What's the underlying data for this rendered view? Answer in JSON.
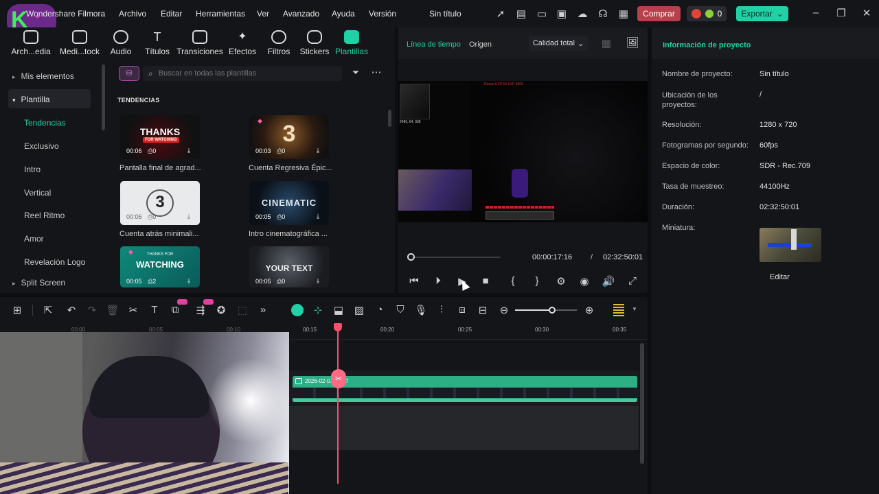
{
  "app": {
    "title": "Wondershare Filmora",
    "project_title": "Sin título"
  },
  "menu": [
    "Archivo",
    "Editar",
    "Herramientas",
    "Ver",
    "Avanzado",
    "Ayuda",
    "Versión"
  ],
  "top_right": {
    "buy_label": "Comprar",
    "credits": "0",
    "export_label": "Exportar"
  },
  "toolbar": [
    {
      "label": "Arch...edia",
      "icon": "import-media-icon"
    },
    {
      "label": "Medi...tock",
      "icon": "stock-media-icon"
    },
    {
      "label": "Audio",
      "icon": "music-note-icon"
    },
    {
      "label": "Títulos",
      "icon": "text-title-icon"
    },
    {
      "label": "Transiciones",
      "icon": "transition-icon"
    },
    {
      "label": "Efectos",
      "icon": "effects-icon"
    },
    {
      "label": "Filtros",
      "icon": "filters-icon"
    },
    {
      "label": "Stickers",
      "icon": "sticker-icon"
    },
    {
      "label": "Plantillas",
      "icon": "templates-icon"
    }
  ],
  "sidebar": [
    {
      "label": "Mis elementos",
      "arrow": "▸"
    },
    {
      "label": "Plantilla",
      "arrow": "▾"
    },
    {
      "label": "Tendencias"
    },
    {
      "label": "Exclusivo"
    },
    {
      "label": "Intro"
    },
    {
      "label": "Vertical"
    },
    {
      "label": "Reel Ritmo"
    },
    {
      "label": "Amor"
    },
    {
      "label": "Revelación Logo"
    },
    {
      "label": "Split Screen",
      "arrow": "▸"
    }
  ],
  "search": {
    "placeholder": "Buscar en todas las plantillas"
  },
  "section_title": "TENDENCIAS",
  "templates": [
    {
      "caption": "Pantalla final de agrad...",
      "duration": "00:06",
      "count": "0",
      "art": "THANKS",
      "art_sub": "FOR WATCHING"
    },
    {
      "caption": "Cuenta Regresiva Épic...",
      "duration": "00:03",
      "count": "0",
      "art": "3",
      "art_sub": ""
    },
    {
      "caption": "Cuenta atrás minimali...",
      "duration": "00:06",
      "count": "0",
      "art": "3",
      "art_sub": ""
    },
    {
      "caption": "Intro cinematográfica ...",
      "duration": "00:05",
      "count": "0",
      "art": "CINEMATIC",
      "art_sub": ""
    },
    {
      "caption": "",
      "duration": "00:05",
      "count": "2",
      "art": "WATCHING",
      "art_sub": "THANKS FOR"
    },
    {
      "caption": "",
      "duration": "00:05",
      "count": "0",
      "art": "YOUR TEXT",
      "art_sub": ""
    }
  ],
  "player": {
    "tab_timeline": "Línea de tiempo",
    "tab_source": "Origen",
    "quality": "Calidad total",
    "current_time": "00:00:17:16",
    "separator": "/",
    "total_time": "02:32:50:01",
    "progress": 0.002
  },
  "project_info": {
    "title": "Información de proyecto",
    "rows": [
      {
        "label": "Nombre de proyecto:",
        "value": "Sin título"
      },
      {
        "label": "Ubicación de los proyectos:",
        "value": "/"
      },
      {
        "label": "Resolución:",
        "value": "1280 x 720"
      },
      {
        "label": "Fotogramas por segundo:",
        "value": "60fps"
      },
      {
        "label": "Espacio de color:",
        "value": "SDR - Rec.709"
      },
      {
        "label": "Tasa de muestreo:",
        "value": "44100Hz"
      },
      {
        "label": "Duración:",
        "value": "02:32:50:01"
      },
      {
        "label": "Miniatura:",
        "value": ""
      }
    ],
    "edit_label": "Editar"
  },
  "timeline": {
    "ruler": [
      "00:15",
      "00:20",
      "00:25",
      "00:30",
      "00:35"
    ],
    "ruler_faded": [
      "00:00",
      "00:05",
      "00:10"
    ],
    "clip_label": "2026-02-0...14-57",
    "zoom": 0.6
  },
  "colors": {
    "accent": "#1fd1a5",
    "buy": "#c0404a",
    "playhead": "#ff4d6d",
    "clip": "#2a9a76"
  }
}
